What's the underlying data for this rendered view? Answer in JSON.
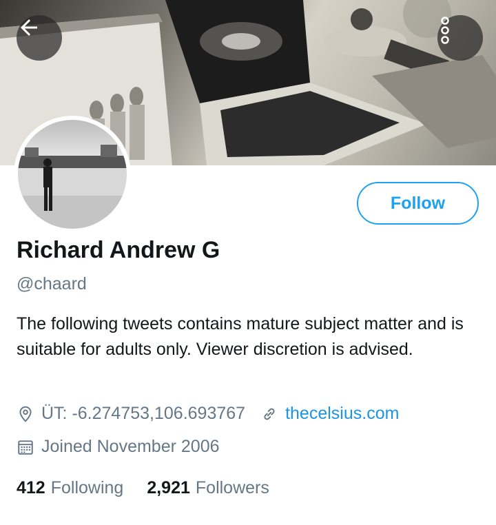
{
  "header": {
    "back_icon": "arrow-left-icon",
    "more_icon": "vertical-dots-icon"
  },
  "profile": {
    "name": "Richard Andrew G",
    "handle": "@chaard",
    "bio": "The following tweets contains mature subject matter and is suitable for adults only. Viewer discretion is advised.",
    "location": "ÜT: -6.274753,106.693767",
    "website": "thecelsius.com",
    "joined": "Joined November 2006"
  },
  "follow_label": "Follow",
  "stats": {
    "following_count": "412",
    "following_label": "Following",
    "followers_count": "2,921",
    "followers_label": "Followers"
  },
  "colors": {
    "accent": "#1da1f2",
    "link": "#1b95e0",
    "secondary_text": "#657786",
    "primary_text": "#14171a"
  }
}
